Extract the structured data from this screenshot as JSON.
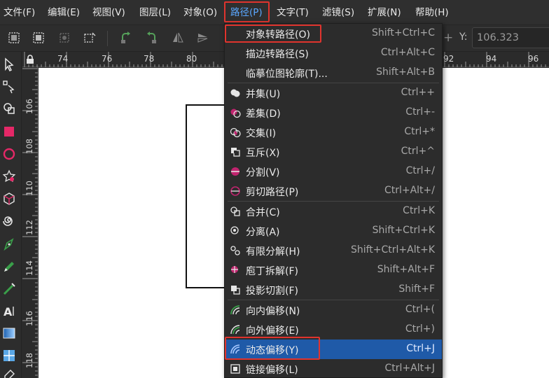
{
  "menubar": {
    "items": [
      "文件(F)",
      "编辑(E)",
      "视图(V)",
      "图层(L)",
      "对象(O)",
      "路径(P)",
      "文字(T)",
      "滤镜(S)",
      "扩展(N)",
      "帮助(H)"
    ]
  },
  "toolbar": {
    "y_label": "Y:",
    "y_value": "106.323"
  },
  "ruler": {
    "top_labels": [
      "74",
      "76",
      "78",
      "80",
      "92",
      "94",
      "96"
    ],
    "left_labels": [
      "106",
      "108",
      "110",
      "112",
      "114",
      "116",
      "118"
    ]
  },
  "path_menu": {
    "items": [
      {
        "label": "对象转路径(O)",
        "shortcut": "Shift+Ctrl+C",
        "icon": "none"
      },
      {
        "label": "描边转路径(S)",
        "shortcut": "Ctrl+Alt+C",
        "icon": "none"
      },
      {
        "label": "临摹位图轮廓(T)...",
        "shortcut": "Shift+Alt+B",
        "icon": "none"
      },
      {
        "label": "并集(U)",
        "shortcut": "Ctrl++",
        "icon": "union-icon"
      },
      {
        "label": "差集(D)",
        "shortcut": "Ctrl+-",
        "icon": "difference-icon"
      },
      {
        "label": "交集(I)",
        "shortcut": "Ctrl+*",
        "icon": "intersection-icon"
      },
      {
        "label": "互斥(X)",
        "shortcut": "Ctrl+^",
        "icon": "exclusion-icon"
      },
      {
        "label": "分割(V)",
        "shortcut": "Ctrl+/",
        "icon": "division-icon"
      },
      {
        "label": "剪切路径(P)",
        "shortcut": "Ctrl+Alt+/",
        "icon": "cut-path-icon"
      },
      {
        "label": "合并(C)",
        "shortcut": "Ctrl+K",
        "icon": "combine-icon"
      },
      {
        "label": "分离(A)",
        "shortcut": "Shift+Ctrl+K",
        "icon": "break-apart-icon"
      },
      {
        "label": "有限分解(H)",
        "shortcut": "Shift+Ctrl+Alt+K",
        "icon": "split-path-icon"
      },
      {
        "label": "庖丁拆解(F)",
        "shortcut": "Shift+Alt+F",
        "icon": "fracture-icon"
      },
      {
        "label": "投影切割(F)",
        "shortcut": "Shift+F",
        "icon": "flatten-icon"
      },
      {
        "label": "向内偏移(N)",
        "shortcut": "Ctrl+(",
        "icon": "inset-icon"
      },
      {
        "label": "向外偏移(E)",
        "shortcut": "Ctrl+)",
        "icon": "outset-icon"
      },
      {
        "label": "动态偏移(Y)",
        "shortcut": "Ctrl+J",
        "icon": "dynamic-offset-icon"
      },
      {
        "label": "链接偏移(L)",
        "shortcut": "Ctrl+Alt+J",
        "icon": "linked-offset-icon"
      }
    ]
  },
  "colors": {
    "highlight_box": "#e0342e",
    "selected_item": "#1f5aa8",
    "active_menu": "#5aa7ff",
    "boolean_accent": "#c0246e",
    "offset_accent": "#3aa04a"
  }
}
